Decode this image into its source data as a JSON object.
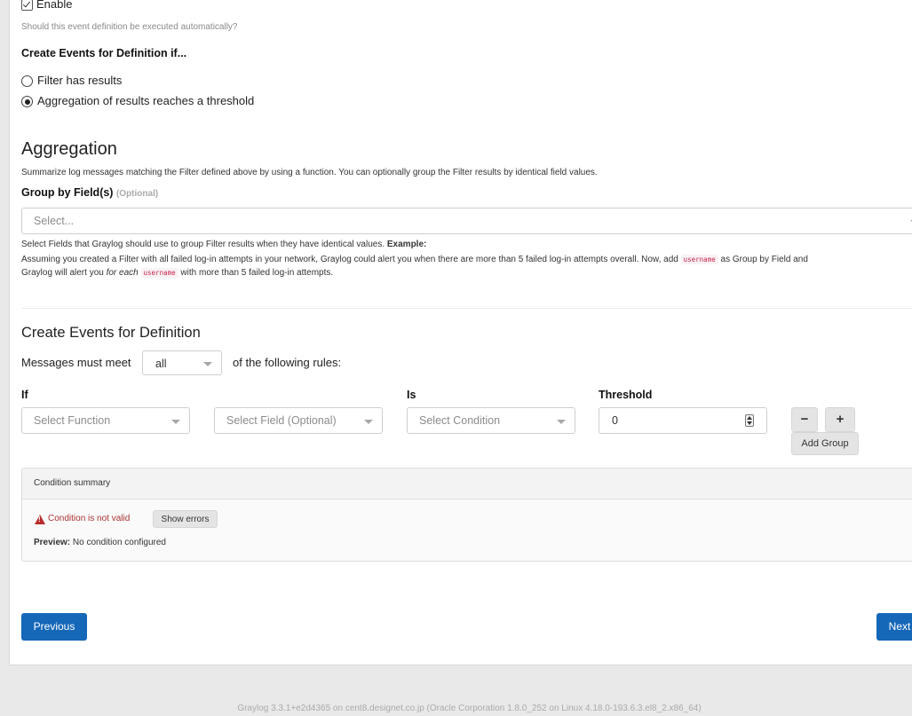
{
  "enable": {
    "label": "Enable",
    "checked": true,
    "help": "Should this event definition be executed automatically?"
  },
  "create_events_if": {
    "title": "Create Events for Definition if...",
    "options": [
      {
        "label": "Filter has results",
        "selected": false
      },
      {
        "label": "Aggregation of results reaches a threshold",
        "selected": true
      }
    ]
  },
  "aggregation": {
    "title": "Aggregation",
    "description": "Summarize log messages matching the Filter defined above by using a function. You can optionally group the Filter results by identical field values.",
    "group_by_label": "Group by Field(s)",
    "group_by_optional": "(Optional)",
    "group_by_placeholder": "Select...",
    "help_line1": "Select Fields that Graylog should use to group Filter results when they have identical values.",
    "help_example_label": "Example:",
    "help_line2_part1": "Assuming you created a Filter with all failed log-in attempts in your network, Graylog could alert you when there are more than 5 failed log-in attempts overall. Now, add",
    "help_code": "username",
    "help_line2_part2": "as Group by Field and",
    "help_line3_part1": "Graylog will alert you",
    "help_line3_em": "for each",
    "help_line3_part2": "with more than 5 failed log-in attempts."
  },
  "create_events": {
    "title": "Create Events for Definition",
    "messages_prefix": "Messages must meet",
    "match_value": "all",
    "messages_suffix": "of the following rules:",
    "col_if": "If",
    "col_is": "Is",
    "col_threshold": "Threshold",
    "function_placeholder": "Select Function",
    "field_placeholder": "Select Field (Optional)",
    "condition_placeholder": "Select Condition",
    "threshold_value": "0",
    "minus_label": "−",
    "plus_label": "+",
    "add_group_label": "Add Group"
  },
  "summary": {
    "title": "Condition summary",
    "error_text": "Condition is not valid",
    "show_errors_label": "Show errors",
    "preview_label": "Preview:",
    "preview_value": "No condition configured"
  },
  "nav": {
    "previous_label": "Previous",
    "next_label": "Next"
  },
  "footer": {
    "text": "Graylog 3.3.1+e2d4365 on cent8.designet.co.jp (Oracle Corporation 1.8.0_252 on Linux 4.18.0-193.6.3.el8_2.x86_64)"
  },
  "colors": {
    "primary_button": "#1567b8",
    "error": "#b72c2c",
    "code_text": "#c7254e",
    "background": "#e9e9e9"
  }
}
